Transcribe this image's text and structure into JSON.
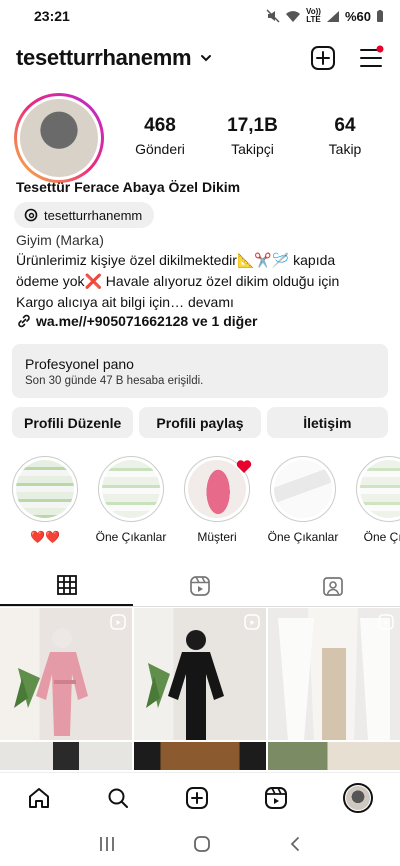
{
  "status": {
    "time": "23:21",
    "net_top": "Vo))",
    "net_bottom": "LTE",
    "battery": "%60"
  },
  "header": {
    "username": "tesetturrhanemm"
  },
  "stats": [
    {
      "value": "468",
      "label": "Gönderi"
    },
    {
      "value": "17,1B",
      "label": "Takipçi"
    },
    {
      "value": "64",
      "label": "Takip"
    }
  ],
  "bio": {
    "name": "Tesettür Ferace Abaya Özel Dikim",
    "threads_handle": "tesetturrhanemm",
    "category": "Giyim (Marka)",
    "line1": "Ürünlerimiz kişiye özel dikilmektedir📐✂️🪡 kapıda",
    "line2": "ödeme yok❌ Havale alıyoruz özel dikim olduğu için",
    "line3": "Kargo alıcıya ait bilgi için… devamı",
    "link": "wa.me//+905071662128 ve 1 diğer"
  },
  "pro_panel": {
    "title": "Profesyonel pano",
    "subtitle": "Son 30 günde 47 B hesaba erişildi."
  },
  "actions": {
    "edit": "Profili Düzenle",
    "share": "Profili paylaş",
    "contact": "İletişim"
  },
  "highlights": [
    {
      "label": "❤️❤️"
    },
    {
      "label": "Öne Çıkanlar"
    },
    {
      "label": "Müşteri"
    },
    {
      "label": "Öne Çıkanlar"
    },
    {
      "label": "Öne Çıka"
    }
  ],
  "colors": {
    "accent_red": "#e8002d",
    "button_bg": "#efefef",
    "highlight_ring": "#cccccc"
  }
}
